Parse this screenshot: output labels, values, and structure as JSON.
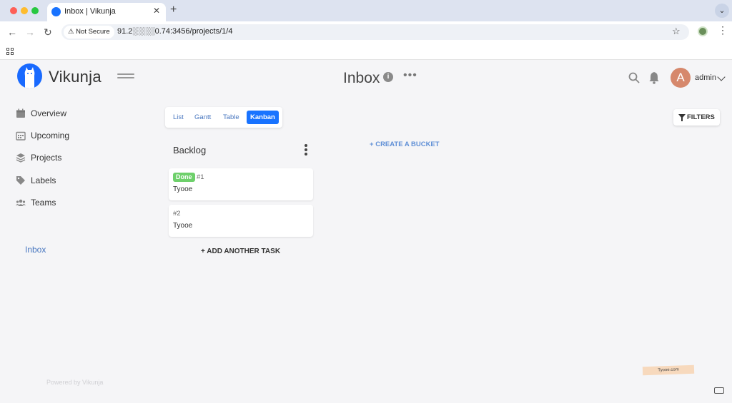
{
  "browser": {
    "tab_title": "Inbox | Vikunja",
    "not_secure_label": "Not Secure",
    "url": "91.2░░░░0.74:3456/projects/1/4"
  },
  "app": {
    "logo_text": "Vikunja",
    "page_title": "Inbox",
    "user_initial": "A",
    "user_name": "admin",
    "accent_color": "#1973ff"
  },
  "sidebar": {
    "menu": [
      {
        "label": "Overview",
        "icon": "calendar-icon"
      },
      {
        "label": "Upcoming",
        "icon": "calendar-grid-icon"
      },
      {
        "label": "Projects",
        "icon": "layers-icon"
      },
      {
        "label": "Labels",
        "icon": "tags-icon"
      },
      {
        "label": "Teams",
        "icon": "users-icon"
      }
    ],
    "projects": [
      {
        "label": "Inbox"
      }
    ],
    "footer": "Powered by Vikunja"
  },
  "views": {
    "tabs": [
      {
        "label": "List",
        "active": false
      },
      {
        "label": "Gantt",
        "active": false
      },
      {
        "label": "Table",
        "active": false
      },
      {
        "label": "Kanban",
        "active": true
      }
    ],
    "filters_label": "FILTERS"
  },
  "kanban": {
    "buckets": [
      {
        "title": "Backlog",
        "tasks": [
          {
            "badge": "Done",
            "id": "#1",
            "title": "Tyooe"
          },
          {
            "badge": "",
            "id": "#2",
            "title": "Tyooe"
          }
        ],
        "add_task_label": "ADD ANOTHER TASK"
      }
    ],
    "create_bucket_label": "CREATE A BUCKET"
  },
  "watermark": "Tyooe.com"
}
